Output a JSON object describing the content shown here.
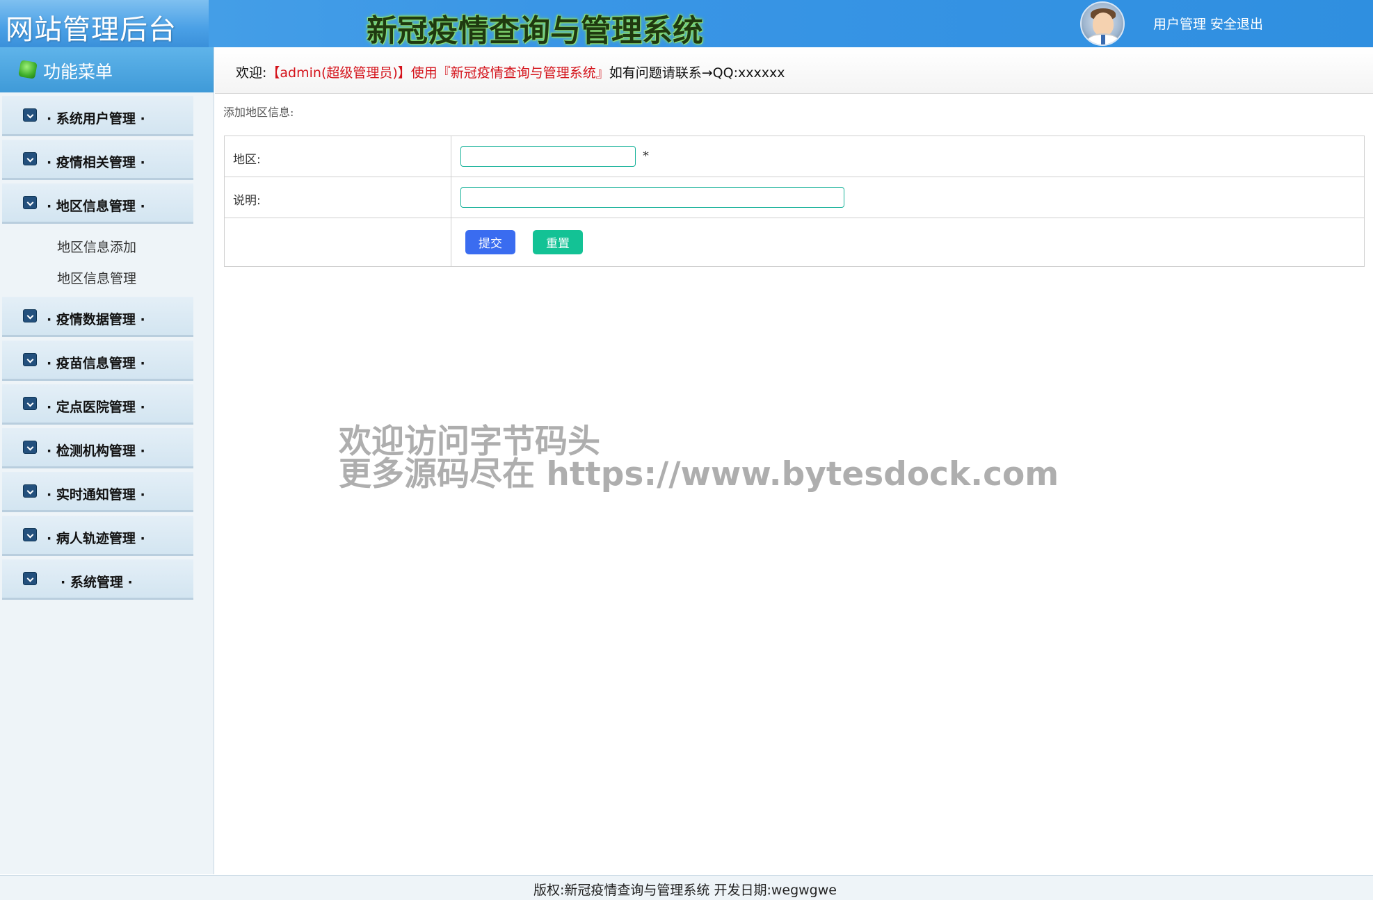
{
  "header": {
    "logo": "网站管理后台",
    "title": "新冠疫情查询与管理系统",
    "links": [
      "用户管理",
      "安全退出"
    ]
  },
  "sidebar": {
    "menu_title": "功能菜单",
    "items": [
      {
        "label": "· 系统用户管理 ·"
      },
      {
        "label": "· 疫情相关管理 ·"
      },
      {
        "label": "· 地区信息管理 ·"
      },
      {
        "label": "· 疫情数据管理 ·"
      },
      {
        "label": "· 疫苗信息管理 ·"
      },
      {
        "label": "· 定点医院管理 ·"
      },
      {
        "label": "· 检测机构管理 ·"
      },
      {
        "label": "· 实时通知管理 ·"
      },
      {
        "label": "· 病人轨迹管理 ·"
      },
      {
        "label": "· 系统管理 ·"
      }
    ],
    "sub_items": [
      "地区信息添加",
      "地区信息管理"
    ]
  },
  "welcome": {
    "prefix": "欢迎:",
    "user": "【admin(超级管理员)】使用『新冠疫情查询与管理系统』",
    "suffix": "如有问题请联系→QQ:xxxxxx"
  },
  "form": {
    "title": "添加地区信息:",
    "region_label": "地区:",
    "region_value": "",
    "required_mark": "*",
    "desc_label": "说明:",
    "desc_value": "",
    "submit_label": "提交",
    "reset_label": "重置"
  },
  "watermark": {
    "line1": "欢迎访问字节码头",
    "line2": "更多源码尽在  https://www.bytesdock.com"
  },
  "footer": {
    "text": "版权:新冠疫情查询与管理系统 开发日期:wegwgwe"
  }
}
